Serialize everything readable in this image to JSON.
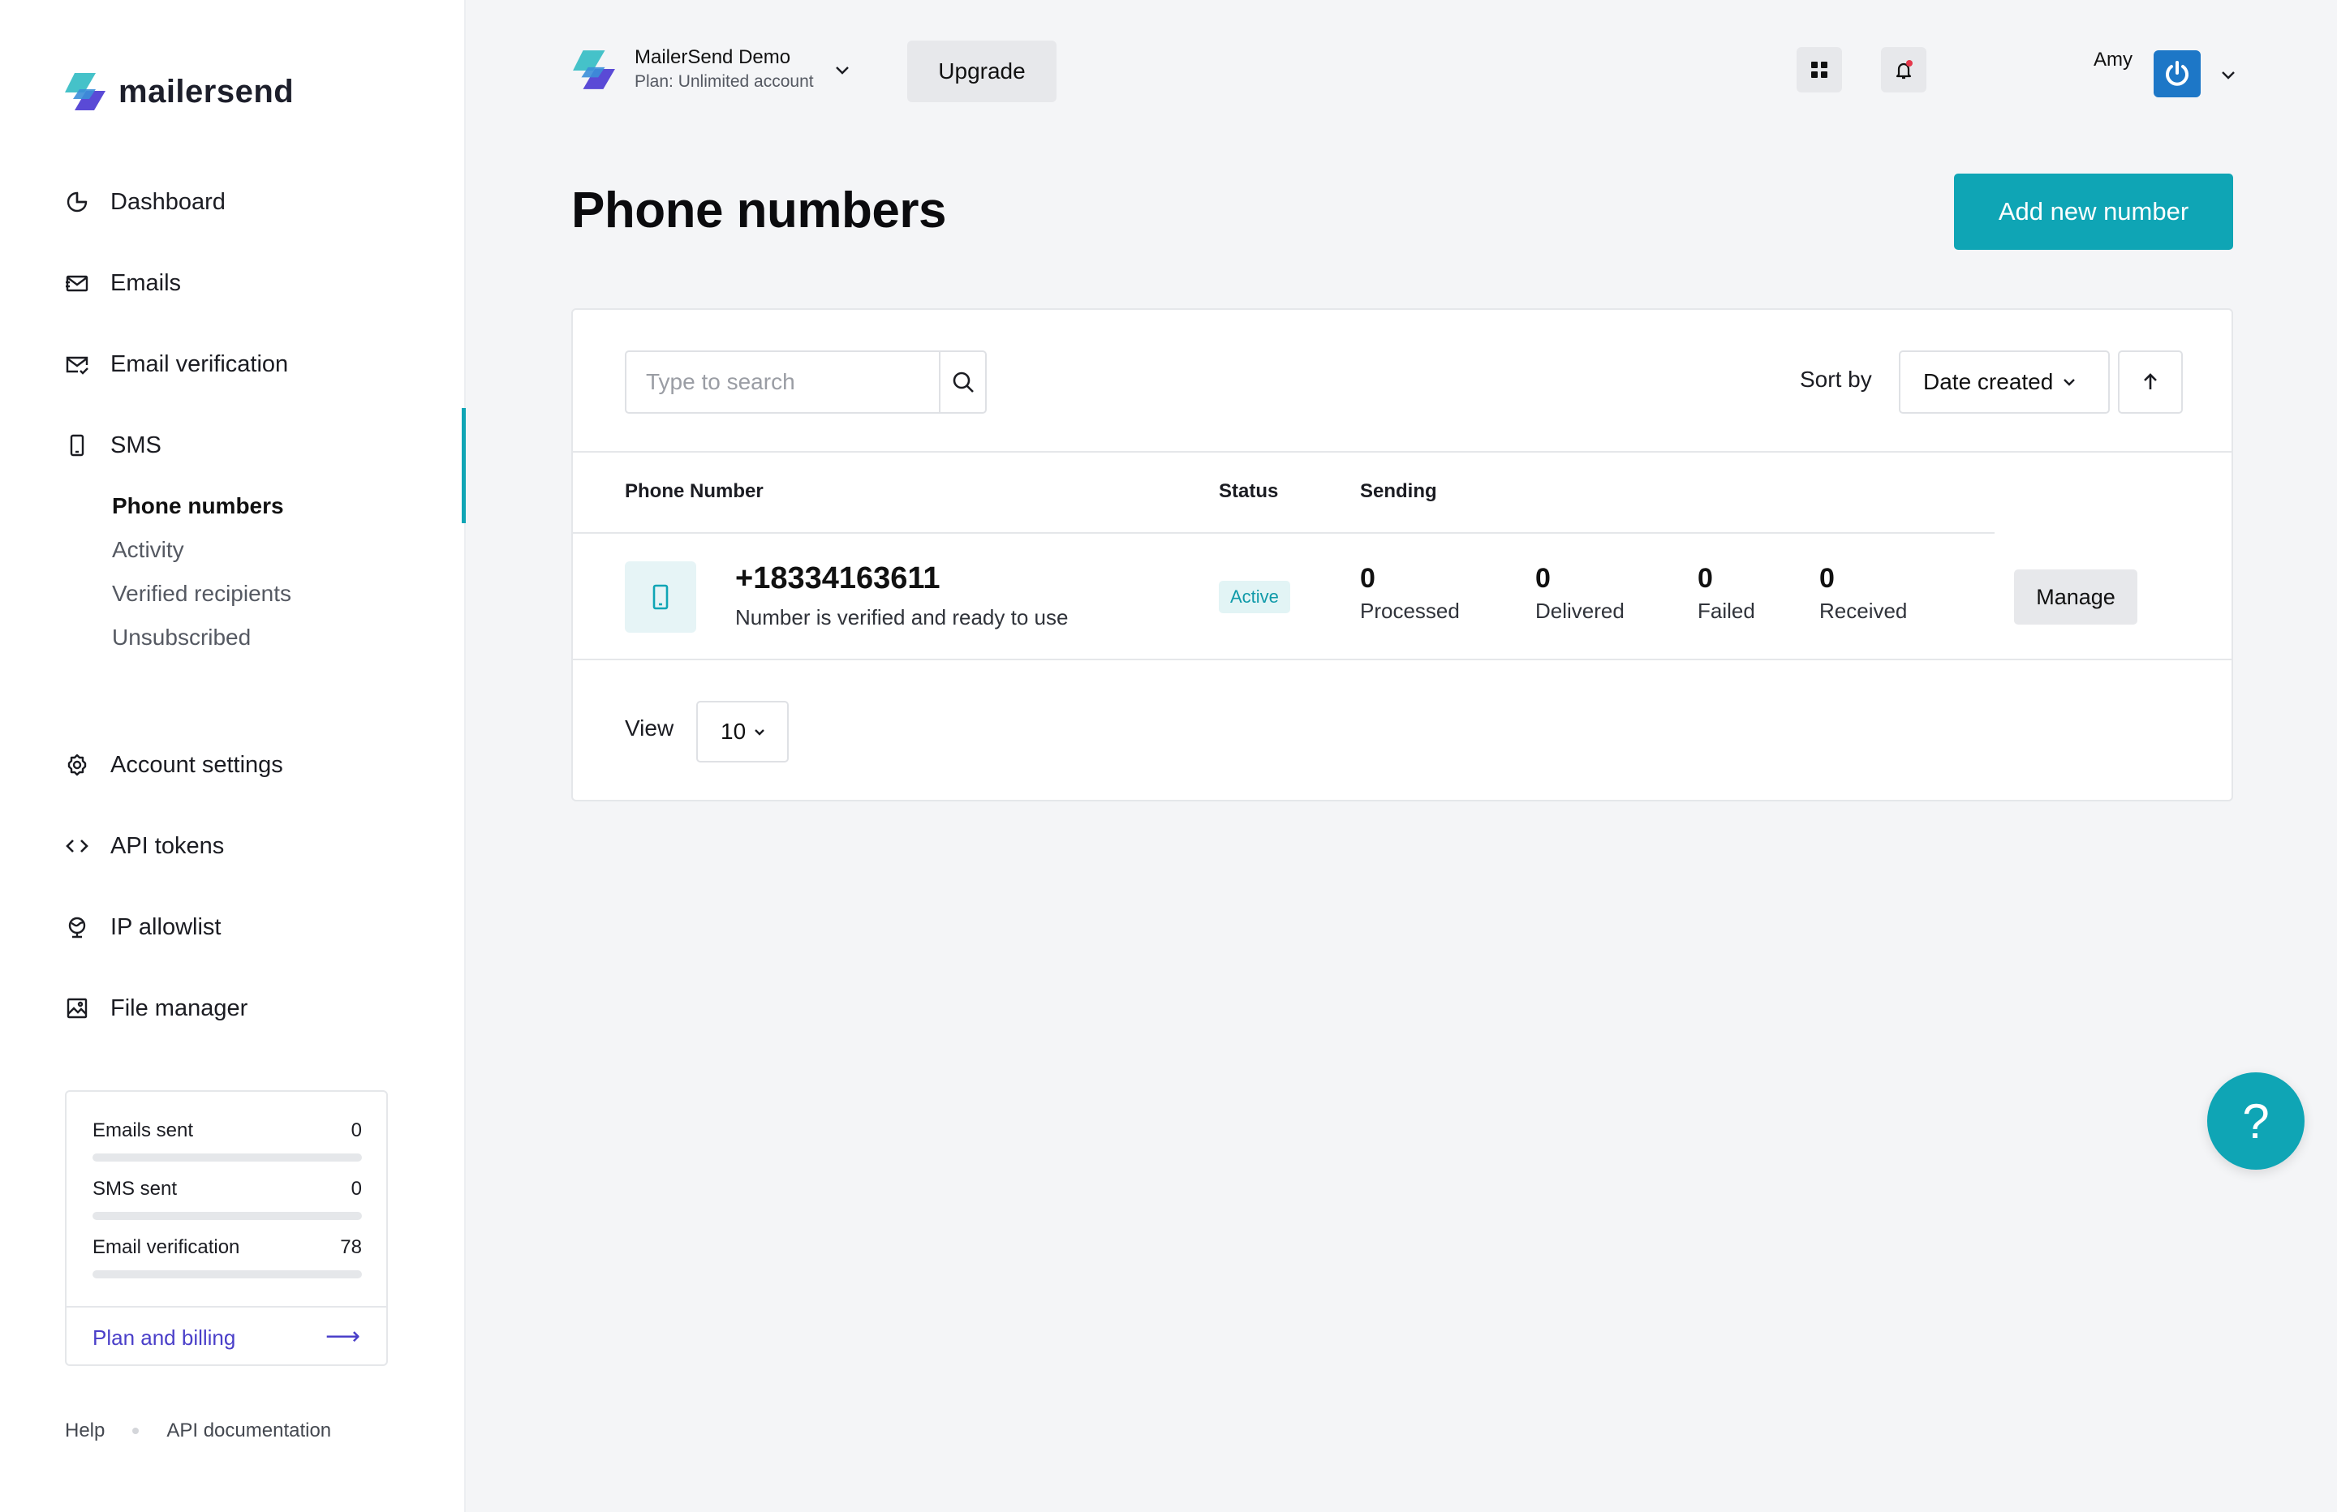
{
  "brand": {
    "name": "mailersend"
  },
  "sidebar": {
    "nav": [
      {
        "label": "Dashboard",
        "icon": "pie-chart-icon"
      },
      {
        "label": "Emails",
        "icon": "email-send-icon"
      },
      {
        "label": "Email verification",
        "icon": "email-check-icon"
      },
      {
        "label": "SMS",
        "icon": "mobile-icon"
      }
    ],
    "sms_subnav": [
      {
        "label": "Phone numbers",
        "active": true
      },
      {
        "label": "Activity"
      },
      {
        "label": "Verified recipients"
      },
      {
        "label": "Unsubscribed"
      }
    ],
    "nav_bottom": [
      {
        "label": "Account settings",
        "icon": "gear-icon"
      },
      {
        "label": "API tokens",
        "icon": "code-icon"
      },
      {
        "label": "IP allowlist",
        "icon": "globe-icon"
      },
      {
        "label": "File manager",
        "icon": "image-icon"
      }
    ],
    "usage": {
      "items": [
        {
          "label": "Emails sent",
          "value": "0",
          "fill": 0
        },
        {
          "label": "SMS sent",
          "value": "0",
          "fill": 0
        },
        {
          "label": "Email verification",
          "value": "78",
          "fill": 0
        }
      ],
      "link": "Plan and billing",
      "link_arrow": "⟶"
    },
    "footer": {
      "help": "Help",
      "api_docs": "API documentation"
    }
  },
  "topbar": {
    "account_name": "MailerSend Demo",
    "account_plan": "Plan: Unlimited account",
    "upgrade": "Upgrade",
    "user_name": "Amy"
  },
  "page": {
    "title": "Phone numbers",
    "add_button": "Add new number"
  },
  "toolbar": {
    "search_placeholder": "Type to search",
    "sort_label": "Sort by",
    "sort_value": "Date created"
  },
  "table": {
    "headers": {
      "phone": "Phone Number",
      "status": "Status",
      "sending": "Sending"
    },
    "rows": [
      {
        "number": "+18334163611",
        "description": "Number is verified and ready to use",
        "status": "Active",
        "stats": [
          {
            "value": "0",
            "label": "Processed"
          },
          {
            "value": "0",
            "label": "Delivered"
          },
          {
            "value": "0",
            "label": "Failed"
          },
          {
            "value": "0",
            "label": "Received"
          }
        ],
        "action": "Manage"
      }
    ]
  },
  "pagination": {
    "view_label": "View",
    "per_page": "10"
  },
  "help": {
    "label": "?"
  },
  "colors": {
    "accent": "#0fa5b5",
    "link": "#4a3fc9",
    "avatar": "#1d77c7",
    "notification_dot": "#e5384b"
  }
}
